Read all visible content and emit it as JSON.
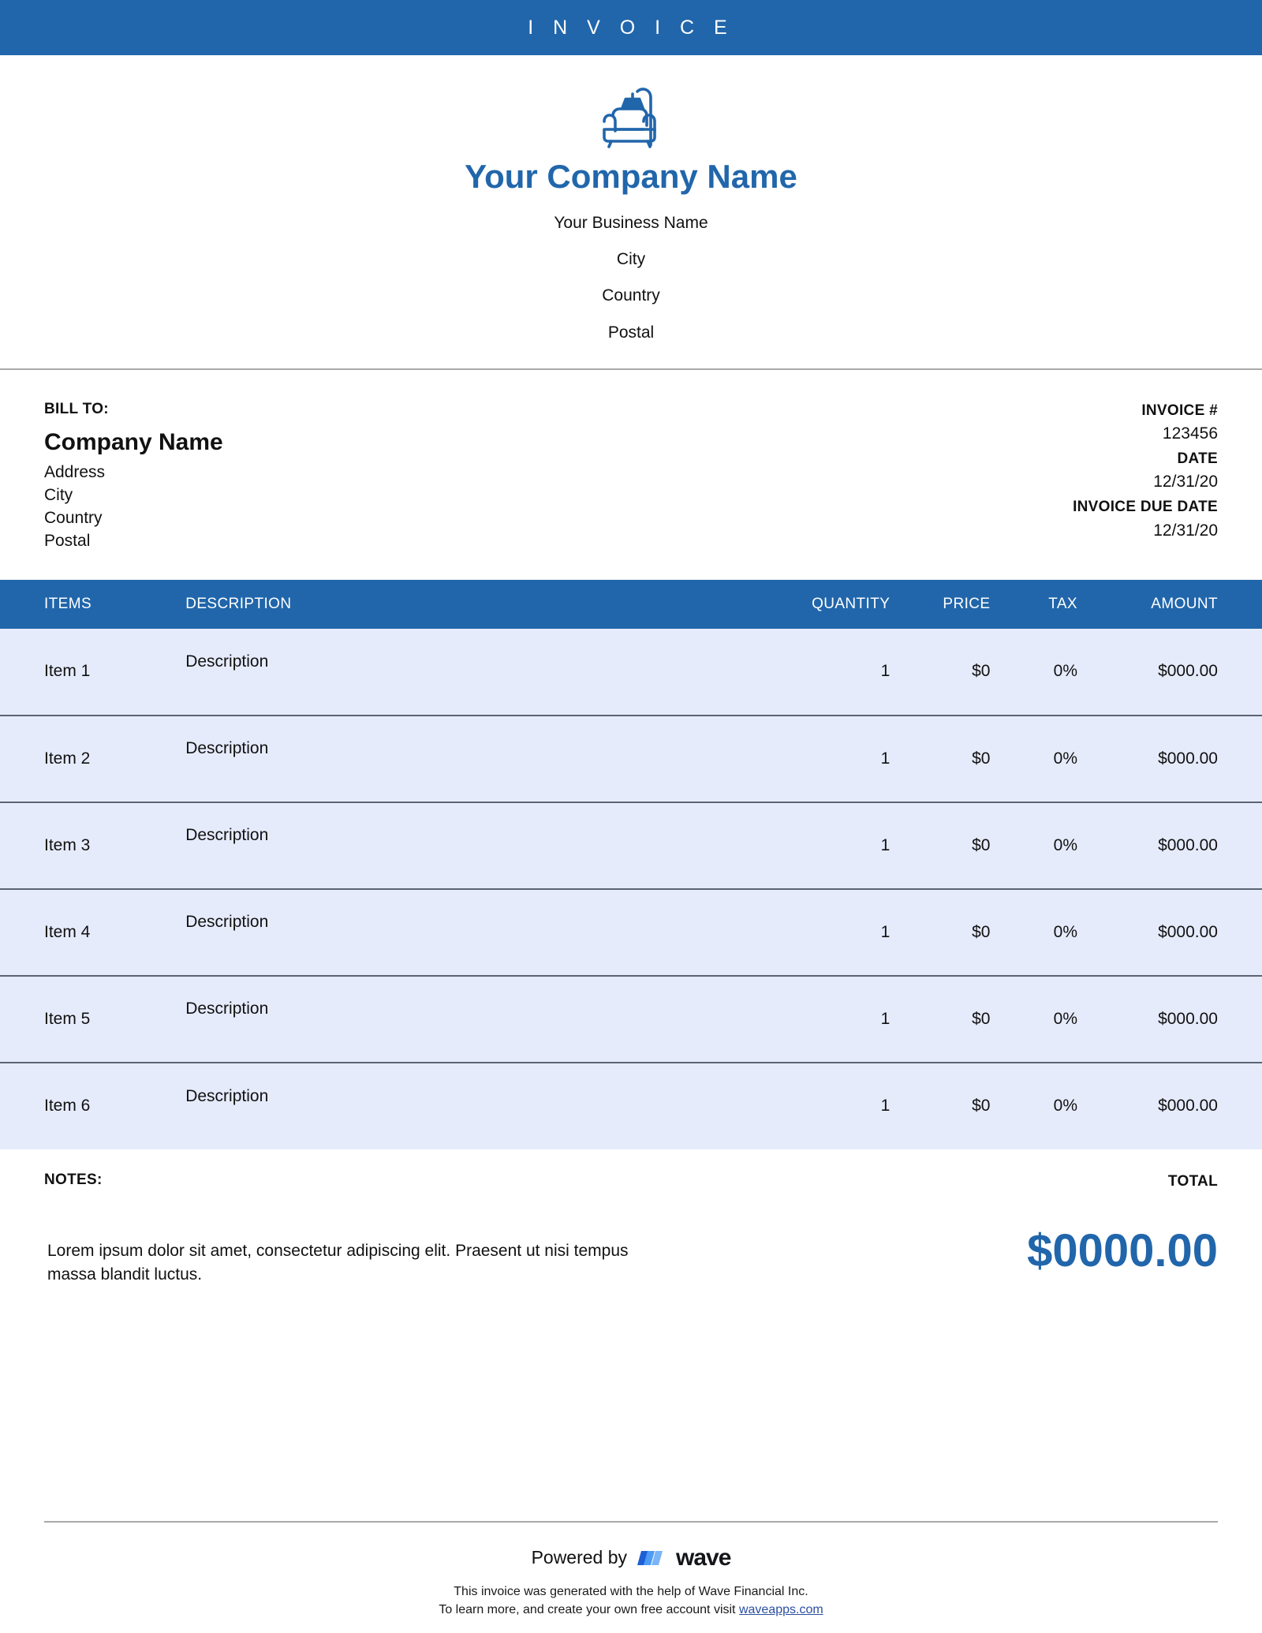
{
  "document": {
    "banner_title": "I N V O I C E",
    "accent_color": "#2166ab",
    "row_background": "#e6ebfc"
  },
  "company": {
    "logo_icon": "armchair-lamp-icon",
    "name": "Your Company Name",
    "business_name": "Your Business Name",
    "city": "City",
    "country": "Country",
    "postal": "Postal"
  },
  "bill_to": {
    "label": "BILL TO:",
    "company": "Company Name",
    "address": "Address",
    "city": "City",
    "country": "Country",
    "postal": "Postal"
  },
  "invoice_meta": {
    "number_label": "INVOICE #",
    "number_value": "123456",
    "date_label": "DATE",
    "date_value": "12/31/20",
    "due_date_label": "INVOICE DUE DATE",
    "due_date_value": "12/31/20"
  },
  "table": {
    "headers": {
      "items": "ITEMS",
      "description": "DESCRIPTION",
      "quantity": "QUANTITY",
      "price": "PRICE",
      "tax": "TAX",
      "amount": "AMOUNT"
    },
    "rows": [
      {
        "item": "Item 1",
        "description": "Description",
        "quantity": "1",
        "price": "$0",
        "tax": "0%",
        "amount": "$000.00"
      },
      {
        "item": "Item 2",
        "description": "Description",
        "quantity": "1",
        "price": "$0",
        "tax": "0%",
        "amount": "$000.00"
      },
      {
        "item": "Item 3",
        "description": "Description",
        "quantity": "1",
        "price": "$0",
        "tax": "0%",
        "amount": "$000.00"
      },
      {
        "item": "Item 4",
        "description": "Description",
        "quantity": "1",
        "price": "$0",
        "tax": "0%",
        "amount": "$000.00"
      },
      {
        "item": "Item 5",
        "description": "Description",
        "quantity": "1",
        "price": "$0",
        "tax": "0%",
        "amount": "$000.00"
      },
      {
        "item": "Item 6",
        "description": "Description",
        "quantity": "1",
        "price": "$0",
        "tax": "0%",
        "amount": "$000.00"
      }
    ]
  },
  "notes": {
    "label": "NOTES:",
    "text": "Lorem ipsum dolor sit amet, consectetur adipiscing elit. Praesent ut nisi tempus massa blandit luctus."
  },
  "total": {
    "label": "TOTAL",
    "value": "$0000.00"
  },
  "footer": {
    "powered_by": "Powered by",
    "wave_logo_icon": "wave-logo-icon",
    "wave_wordmark": "wave",
    "note_line_1": "This invoice was generated with the help of Wave Financial Inc.",
    "note_line_2_prefix": "To learn more, and create your own free account visit ",
    "note_link": "waveapps.com"
  }
}
